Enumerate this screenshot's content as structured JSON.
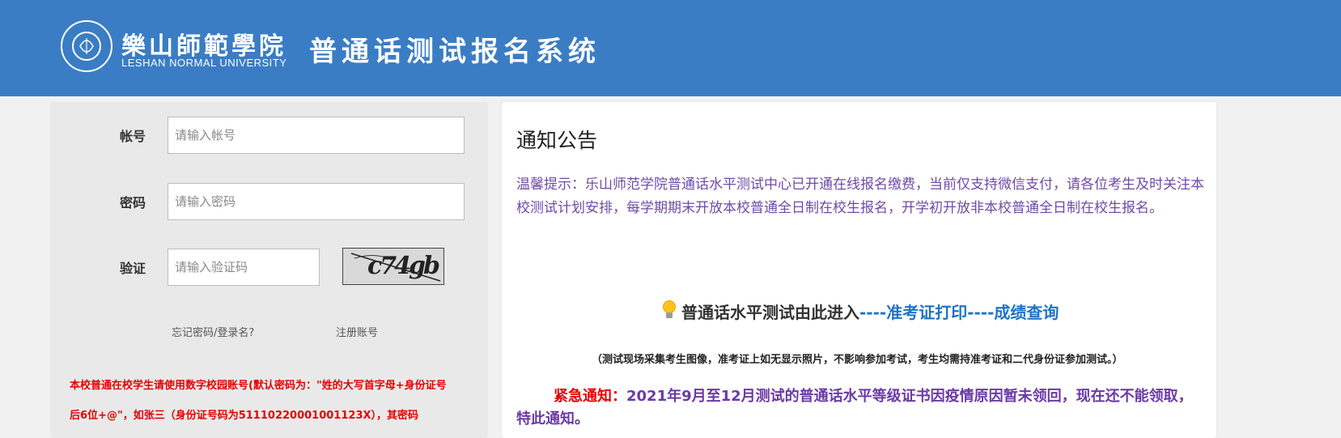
{
  "header": {
    "university_cn": "樂山師範學院",
    "university_en": "LESHAN NORMAL UNIVERSITY",
    "system_title": "普通话测试报名系统",
    "logo_icon": "university-seal-icon"
  },
  "login": {
    "account_label": "帐号",
    "account_placeholder": "请输入帐号",
    "password_label": "密码",
    "password_placeholder": "请输入密码",
    "captcha_label": "验证",
    "captcha_placeholder": "请输入验证码",
    "captcha_text": "c74gb",
    "forgot_link": "忘记密码/登录名?",
    "register_link": "注册账号",
    "note_line1": "本校普通在校学生请使用数字校园账号(默认密码为：\"姓的大写首字母+身份证号",
    "note_line2": "后6位+@\"，如张三（身份证号码为51110220001001123X），其密码"
  },
  "notice": {
    "title": "通知公告",
    "tip": "温馨提示：乐山师范学院普通话水平测试中心已开通在线报名缴费，当前仅支持微信支付，请各位考生及时关注本校测试计划安排，每学期期末开放本校普通全日制在校生报名，开学初开放非本校普通全日制在校生报名。",
    "entry_icon": "lightbulb-icon",
    "entry_main": "普通话水平测试由此进入",
    "entry_sep1": "----",
    "entry_admission": "准考证打印",
    "entry_sep2": "----",
    "entry_score": "成绩查询",
    "sub_note": "（测试现场采集考生图像，准考证上如无显示照片，不影响参加考试，考生均需持准考证和二代身份证参加测试。）",
    "urgent_label": "紧急通知：",
    "urgent_text": "2021年9月至12月测试的普通话水平等级证书因疫情原因暂未领回，现在还不能领取，特此通知。"
  },
  "colors": {
    "header_bg": "#3a7dc4",
    "link_blue": "#1e73c8",
    "tip_purple": "#6f4aa8",
    "alert_red": "#e60000"
  }
}
